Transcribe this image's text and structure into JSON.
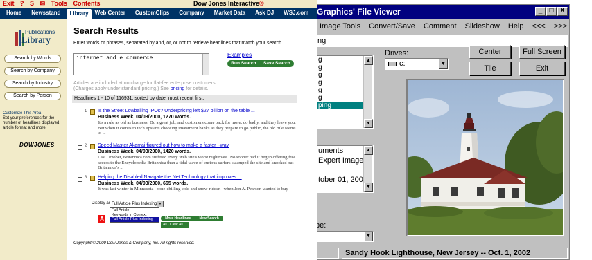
{
  "viewer": {
    "title": "Graphics' File Viewer",
    "window_buttons": [
      "_",
      "□",
      "X"
    ],
    "menu": [
      "Image Tools",
      "Convert/Save",
      "Comment",
      "Slideshow",
      "Help",
      "<<<",
      ">>>"
    ],
    "path_value": "ng",
    "file_list": [
      "g",
      "g",
      "g",
      "g",
      "g",
      "g",
      "ping"
    ],
    "file_list_selected_index": 6,
    "drives_label": "Drives:",
    "drive_value": "c:",
    "buttons": {
      "center": "Center",
      "full_screen": "Full Screen",
      "tile": "Tile",
      "exit": "Exit"
    },
    "comment_lines": [
      "uments",
      "Expert Images",
      "",
      "tober 01, 2002"
    ],
    "type_label": "pe:",
    "status_caption": "Sandy Hook Lighthouse, New Jersey -- Oct. 1, 2002",
    "colors": {
      "title_bg": "#000080",
      "selection": "#008080",
      "face": "#c0c0c0"
    }
  },
  "library": {
    "toolbar_links": [
      "Exit",
      "?",
      "S",
      "✉",
      "Tools",
      "Contents"
    ],
    "brand": "Dow Jones Interactive",
    "brand_mark": "®",
    "nav_tabs": [
      "Home",
      "Newsstand",
      "Library",
      "Web Center",
      "CustomClips",
      "Company",
      "Market Data",
      "Ask DJ",
      "WSJ.com"
    ],
    "active_tab": "Library",
    "logo_small": "Publications",
    "logo_big": "Library",
    "side_buttons": [
      "Search by Words",
      "Search by Company",
      "Search by Industry",
      "Search by Person"
    ],
    "customize_head": "Customize This Area",
    "customize_text": "Set your preferences for the number of headlines displayed, article format and more.",
    "dj_logo": "DOWJONES",
    "page_title": "Search Results",
    "instructions": "Enter words or phrases, separated by and, or, or not to retrieve headlines that match your search.",
    "query": "internet and e commerce",
    "examples_link": "Examples",
    "run_search": "Run Search",
    "save_search": "Save Search",
    "fineprint_1": "Articles are included at no charge for flat-fee enterprise customers.",
    "fineprint_2": "(Charges apply under standard pricing.) See",
    "pricing_link": "pricing",
    "fineprint_3": "for details.",
    "headline_bar": "Headlines 1 - 10 of 116931, sorted by date, most recent first.",
    "results": [
      {
        "num": "1",
        "title": "Is the Street Lowballing IPOs? Underpricing left $27 billion on the table ...",
        "meta": "Business Week, 04/03/2000, 1270 words.",
        "snippet": "It's a rule as old as business: Do a great job, and customers come back for more; do badly, and they leave you. But when it comes to tech upstarts choosing investment banks as they prepare to go public, the old rule seems to ..."
      },
      {
        "num": "2",
        "title": "Speed Master Akamai figured out how to make a faster I-way",
        "meta": "Business Week, 04/03/2000, 1420 words.",
        "snippet": "Last October, Britannica.com suffered every Web site's worst nightmare. No sooner had it begun offering free access to the Encyclopedia Britannica than a tidal wave of curious surfers swamped the site and knocked out Britannica's ..."
      },
      {
        "num": "3",
        "title": "Helping the Disabled Navigate the Net Technology that improves ...",
        "meta": "Business Week, 04/03/2000, 665 words.",
        "snippet": "It was last winter in Minnesota--bone-chilling cold and snow-ridden--when Jon A. Pearson wanted to buy"
      }
    ],
    "display_as_label": "Display as",
    "display_value": "Full Article Plus Indexing",
    "display_options": [
      "Full Article",
      "Keywords in Context",
      "Full Article Plus Indexing"
    ],
    "display_selected_index": 2,
    "more_headlines": "More Headlines",
    "new_search": "New Search",
    "check_all": "All · Clear All",
    "copyright": "Copyright © 2000 Dow Jones & Company, Inc. All rights reserved.",
    "colors": {
      "nav": "#003366",
      "sidebar": "#f2ebc9",
      "green_btn": "#2e7d32"
    }
  }
}
